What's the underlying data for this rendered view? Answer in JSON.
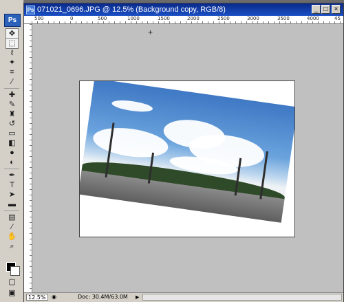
{
  "app": {
    "badge": "Ps"
  },
  "document": {
    "title": "071021_0696.JPG @ 12.5% (Background copy, RGB/8)",
    "doc_icon": "Ps",
    "window_buttons": {
      "minimize": "_",
      "maximize": "□",
      "close": "×"
    }
  },
  "ruler": {
    "top_labels": [
      "500",
      "0",
      "500",
      "1000",
      "1500",
      "2000",
      "2500",
      "3000",
      "3500",
      "4000",
      "45"
    ]
  },
  "tools": [
    {
      "name": "move-tool",
      "glyph": "✥"
    },
    {
      "name": "marquee-tool",
      "glyph": "⬚"
    },
    {
      "name": "lasso-tool",
      "glyph": "ℓ"
    },
    {
      "name": "magic-wand-tool",
      "glyph": "✦"
    },
    {
      "name": "crop-tool",
      "glyph": "⌗"
    },
    {
      "name": "slice-tool",
      "glyph": "∕"
    },
    {
      "name": "healing-brush-tool",
      "glyph": "✚"
    },
    {
      "name": "brush-tool",
      "glyph": "✎"
    },
    {
      "name": "clone-stamp-tool",
      "glyph": "♜"
    },
    {
      "name": "history-brush-tool",
      "glyph": "↺"
    },
    {
      "name": "eraser-tool",
      "glyph": "▭"
    },
    {
      "name": "gradient-tool",
      "glyph": "◧"
    },
    {
      "name": "blur-tool",
      "glyph": "●"
    },
    {
      "name": "dodge-tool",
      "glyph": "◐"
    },
    {
      "name": "pen-tool",
      "glyph": "✒"
    },
    {
      "name": "type-tool",
      "glyph": "T"
    },
    {
      "name": "path-selection-tool",
      "glyph": "➤"
    },
    {
      "name": "shape-tool",
      "glyph": "▬"
    },
    {
      "name": "notes-tool",
      "glyph": "▤"
    },
    {
      "name": "eyedropper-tool",
      "glyph": "⁄"
    },
    {
      "name": "hand-tool",
      "glyph": "✋"
    },
    {
      "name": "zoom-tool",
      "glyph": "⌕"
    }
  ],
  "status": {
    "zoom": "12.5%",
    "doc_info": "Doc: 30.4M/63.0M",
    "arrow": "▶"
  },
  "colors": {
    "foreground": "#000000",
    "background": "#ffffff",
    "title_bar": "#1a4fc4",
    "canvas_bg": "#c0c0c0"
  }
}
